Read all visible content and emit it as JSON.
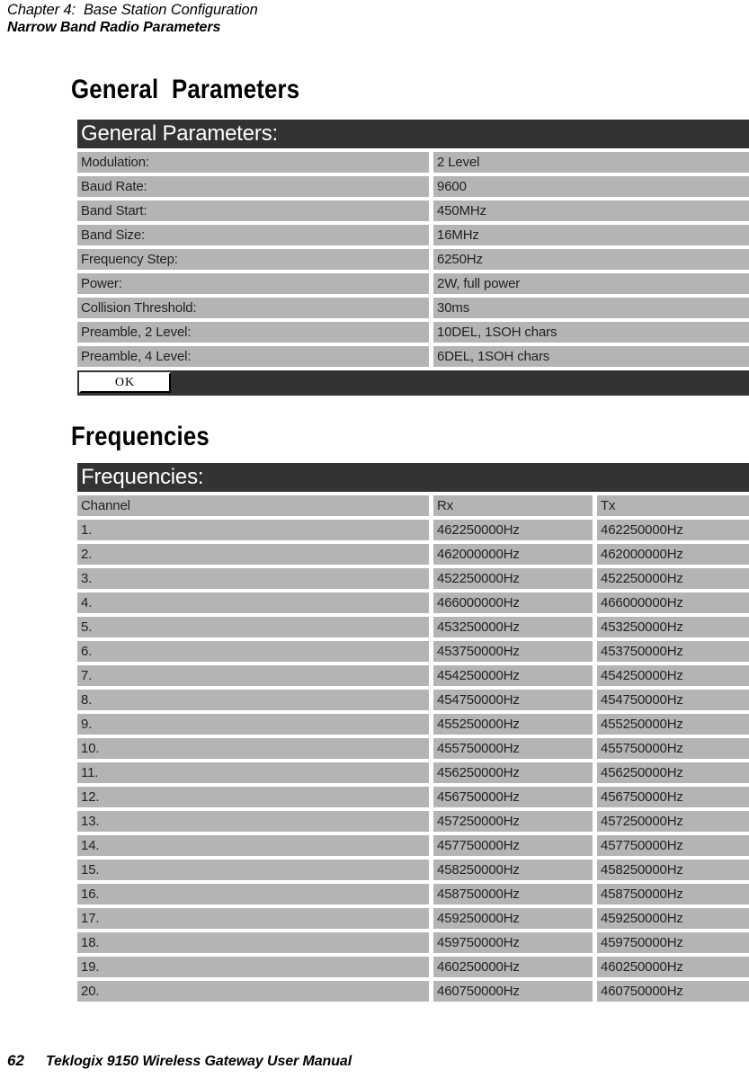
{
  "running_head": {
    "chapter": "Chapter 4:  Base Station Configuration",
    "subject": "Narrow Band Radio Parameters"
  },
  "sections": {
    "general": {
      "heading": "General  Parameters",
      "panel_title": "General Parameters:",
      "ok_label": "OK",
      "rows": [
        {
          "label": "Modulation:",
          "value": "2 Level"
        },
        {
          "label": "Baud Rate:",
          "value": "9600"
        },
        {
          "label": "Band Start:",
          "value": "450MHz"
        },
        {
          "label": "Band Size:",
          "value": "16MHz"
        },
        {
          "label": "Frequency Step:",
          "value": "6250Hz"
        },
        {
          "label": "Power:",
          "value": "2W, full power"
        },
        {
          "label": "Collision Threshold:",
          "value": "30ms"
        },
        {
          "label": "Preamble, 2 Level:",
          "value": "10DEL, 1SOH chars"
        },
        {
          "label": "Preamble, 4 Level:",
          "value": "6DEL, 1SOH chars"
        }
      ]
    },
    "frequencies": {
      "heading": "Frequencies",
      "panel_title": "Frequencies:",
      "columns": {
        "channel": "Channel",
        "rx": "Rx",
        "tx": "Tx"
      },
      "rows": [
        {
          "channel": "1.",
          "rx": "462250000Hz",
          "tx": "462250000Hz"
        },
        {
          "channel": "2.",
          "rx": "462000000Hz",
          "tx": "462000000Hz"
        },
        {
          "channel": "3.",
          "rx": "452250000Hz",
          "tx": "452250000Hz"
        },
        {
          "channel": "4.",
          "rx": "466000000Hz",
          "tx": "466000000Hz"
        },
        {
          "channel": "5.",
          "rx": "453250000Hz",
          "tx": "453250000Hz"
        },
        {
          "channel": "6.",
          "rx": "453750000Hz",
          "tx": "453750000Hz"
        },
        {
          "channel": "7.",
          "rx": "454250000Hz",
          "tx": "454250000Hz"
        },
        {
          "channel": "8.",
          "rx": "454750000Hz",
          "tx": "454750000Hz"
        },
        {
          "channel": "9.",
          "rx": "455250000Hz",
          "tx": "455250000Hz"
        },
        {
          "channel": "10.",
          "rx": "455750000Hz",
          "tx": "455750000Hz"
        },
        {
          "channel": "11.",
          "rx": "456250000Hz",
          "tx": "456250000Hz"
        },
        {
          "channel": "12.",
          "rx": "456750000Hz",
          "tx": "456750000Hz"
        },
        {
          "channel": "13.",
          "rx": "457250000Hz",
          "tx": "457250000Hz"
        },
        {
          "channel": "14.",
          "rx": "457750000Hz",
          "tx": "457750000Hz"
        },
        {
          "channel": "15.",
          "rx": "458250000Hz",
          "tx": "458250000Hz"
        },
        {
          "channel": "16.",
          "rx": "458750000Hz",
          "tx": "458750000Hz"
        },
        {
          "channel": "17.",
          "rx": "459250000Hz",
          "tx": "459250000Hz"
        },
        {
          "channel": "18.",
          "rx": "459750000Hz",
          "tx": "459750000Hz"
        },
        {
          "channel": "19.",
          "rx": "460250000Hz",
          "tx": "460250000Hz"
        },
        {
          "channel": "20.",
          "rx": "460750000Hz",
          "tx": "460750000Hz"
        }
      ]
    }
  },
  "page_footer": {
    "page_number": "62",
    "manual_title": "Teklogix 9150 Wireless Gateway User Manual"
  },
  "colors": {
    "titlebar": "#333333",
    "cell": "#b4b4b4",
    "page": "#ffffff"
  }
}
